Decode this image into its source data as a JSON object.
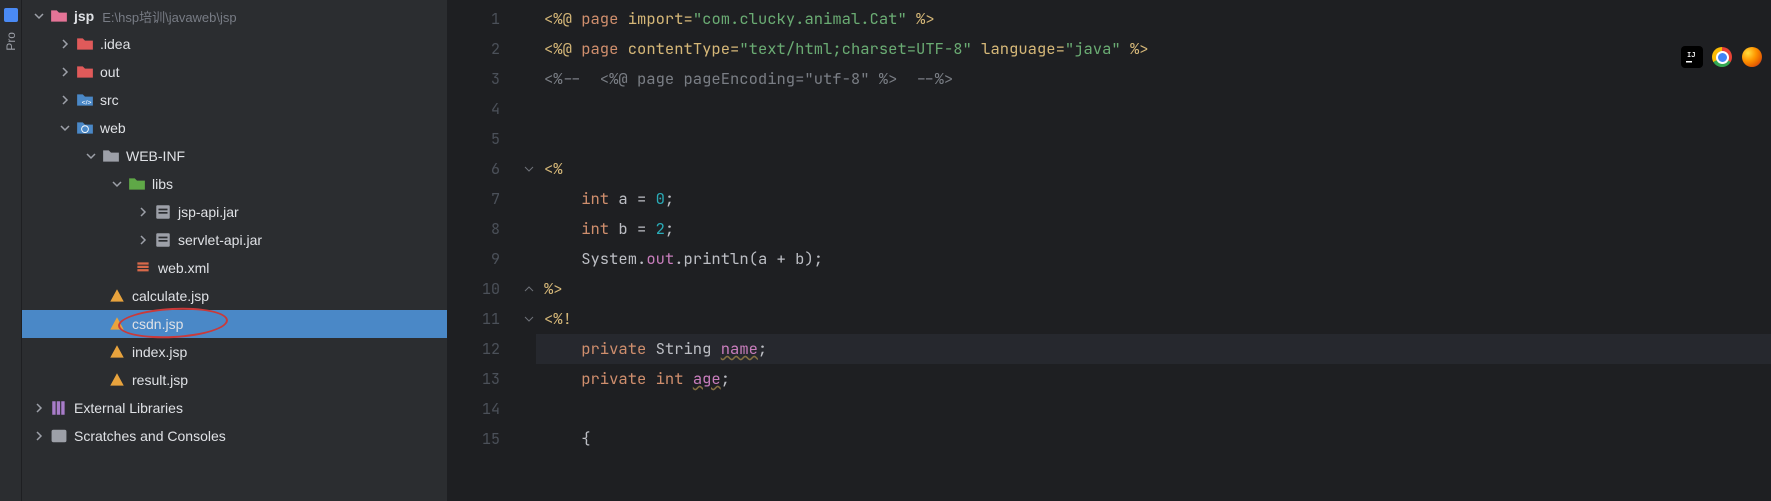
{
  "project": {
    "root": {
      "name": "jsp",
      "path": "E:\\hsp培训\\javaweb\\jsp"
    },
    "idea": ".idea",
    "out": "out",
    "src": "src",
    "web": "web",
    "webinf": "WEB-INF",
    "libs": "libs",
    "jspapi": "jsp-api.jar",
    "servletapi": "servlet-api.jar",
    "webxml": "web.xml",
    "calculate": "calculate.jsp",
    "csdn": "csdn.jsp",
    "index": "index.jsp",
    "result": "result.jsp",
    "extlib": "External Libraries",
    "scratches": "Scratches and Consoles"
  },
  "lefttab": "Pro",
  "lines": [
    "1",
    "2",
    "3",
    "4",
    "5",
    "6",
    "7",
    "8",
    "9",
    "10",
    "11",
    "12",
    "13",
    "14",
    "15"
  ],
  "code": {
    "l1": {
      "d1": "<%@ ",
      "k1": "page ",
      "k2": "import",
      "eq": "=",
      "s1": "\"com.clucky.animal.Cat\"",
      "d2": " %>"
    },
    "l2": {
      "d1": "<%@ ",
      "k1": "page ",
      "k2": "contentType",
      "eq1": "=",
      "s1": "\"text/html;charset=UTF-8\"",
      "sp": " ",
      "k3": "language",
      "eq2": "=",
      "s2": "\"java\"",
      "d2": " %>"
    },
    "l3": {
      "c1": "<%--  <%@ page pageEncoding=\"utf-8\" %>  --%>"
    },
    "l6": {
      "d1": "<%"
    },
    "l7": {
      "indent": "    ",
      "k1": "int ",
      "v1": "a = ",
      "n1": "0",
      "sc": ";"
    },
    "l8": {
      "indent": "    ",
      "k1": "int ",
      "v1": "b = ",
      "n1": "2",
      "sc": ";"
    },
    "l9": {
      "indent": "    ",
      "cls": "System.",
      "out": "out",
      "dot": ".",
      "m": "println",
      "p": "(a + b);"
    },
    "l10": {
      "d1": "%>"
    },
    "l11": {
      "d1": "<%!"
    },
    "l12": {
      "indent": "    ",
      "k1": "private ",
      "t1": "String ",
      "v1": "name",
      "sc": ";"
    },
    "l13": {
      "indent": "    ",
      "k1": "private ",
      "t1": "int ",
      "v1": "age",
      "sc": ";"
    },
    "l15": {
      "indent": "    ",
      "b": "{"
    }
  }
}
